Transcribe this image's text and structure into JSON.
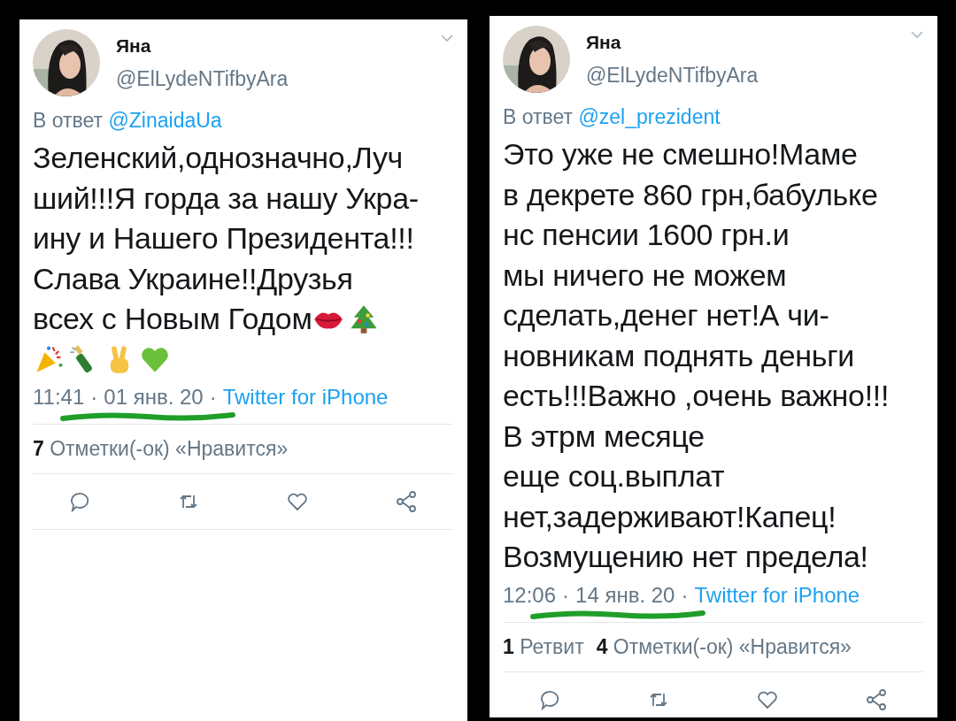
{
  "tweets": [
    {
      "author": {
        "name": "Яна",
        "handle": "@ElLydeNTifbyAra"
      },
      "reply_prefix": "В ответ",
      "reply_to": "@ZinaidaUa",
      "lines": [
        {
          "text": "Зеленский,однозначно,Луч"
        },
        {
          "text": "ший!!!Я горда за нашу Укра-"
        },
        {
          "text": "ину и Нашего Президента!!!"
        },
        {
          "text": "Слава Украине!!Друзья"
        },
        {
          "text": "всех с Новым Годом",
          "emoji": [
            {
              "kind": "lips"
            },
            {
              "kind": "tree"
            }
          ]
        },
        {
          "emoji": [
            {
              "kind": "party"
            },
            {
              "kind": "champagne"
            },
            {
              "kind": "victory"
            },
            {
              "kind": "heart"
            }
          ]
        }
      ],
      "time": "11:41",
      "separator": "·",
      "date": "01 янв. 20",
      "source": "Twitter for iPhone",
      "stats": [
        {
          "count": "7",
          "label": "Отметки(-ок) «Нравится»"
        }
      ]
    },
    {
      "author": {
        "name": "Яна",
        "handle": "@ElLydeNTifbyAra"
      },
      "reply_prefix": "В ответ",
      "reply_to": "@zel_prezident",
      "lines": [
        {
          "text": "Это уже не смешно!Маме"
        },
        {
          "text": "в декрете 860 грн,бабульке"
        },
        {
          "text": "нс пенсии 1600 грн.и"
        },
        {
          "text": "мы ничего не можем"
        },
        {
          "text": "сделать,денег нет!А чи-"
        },
        {
          "text": "новникам поднять деньги"
        },
        {
          "text": "есть!!!Важно ,очень важно!!!"
        },
        {
          "text": "В этрм месяце"
        },
        {
          "text": "еще соц.выплат"
        },
        {
          "text": "нет,задерживают!Капец!"
        },
        {
          "text": "Возмущению нет предела!"
        }
      ],
      "time": "12:06",
      "separator": "·",
      "date": "14 янв. 20",
      "source": "Twitter for iPhone",
      "stats": [
        {
          "count": "1",
          "label": "Ретвит"
        },
        {
          "count": "4",
          "label": "Отметки(-ок) «Нравится»"
        }
      ]
    }
  ]
}
